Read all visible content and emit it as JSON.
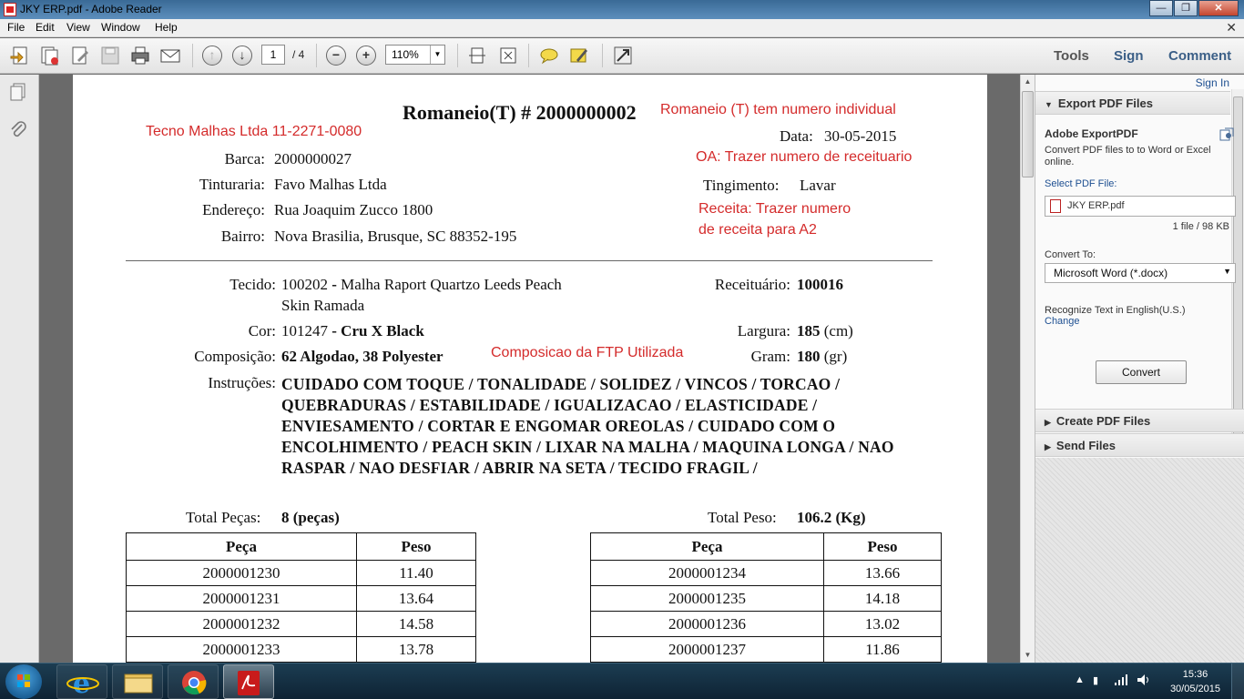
{
  "window": {
    "title": "JKY ERP.pdf - Adobe Reader",
    "buttons": {
      "minimize": "—",
      "maximize": "❐",
      "close": "✕"
    }
  },
  "menu": [
    "File",
    "Edit",
    "View",
    "Window",
    "Help"
  ],
  "toolbar": {
    "page_current": "1",
    "page_total": "/ 4",
    "zoom": "110%",
    "links": [
      "Tools",
      "Sign",
      "Comment"
    ]
  },
  "document": {
    "title": "Romaneio(T) # 2000000002",
    "header_left": [
      {
        "label": "Barca:",
        "value": "2000000027"
      },
      {
        "label": "Tinturaria:",
        "value": "Favo Malhas Ltda"
      },
      {
        "label": "Endereço:",
        "value": "Rua Joaquim Zucco 1800"
      },
      {
        "label": "Bairro:",
        "value": "Nova Brasilia, Brusque, SC 88352-195"
      }
    ],
    "date": {
      "label": "Data:",
      "value": "30-05-2015"
    },
    "tingimento": {
      "label": "Tingimento:",
      "value": "Lavar"
    },
    "tecido": {
      "label": "Tecido:",
      "code": "100202",
      "sep": " - ",
      "line1": "Malha Raport Quartzo Leeds Peach",
      "line2": "Skin Ramada"
    },
    "cor": {
      "label": "Cor:",
      "code": "101247",
      "value": " - Cru X Black"
    },
    "composicao": {
      "label": "Composição:",
      "value": "62 Algodao, 38 Polyester"
    },
    "receituario": {
      "label": "Receituário:",
      "value": "100016"
    },
    "largura": {
      "label": "Largura:",
      "value": "185",
      "unit": " (cm)"
    },
    "gram": {
      "label": "Gram:",
      "value": "180",
      "unit": " (gr)"
    },
    "instrucoes": {
      "label": "Instruções:",
      "text": "CUIDADO COM TOQUE / TONALIDADE / SOLIDEZ / VINCOS / TORCAO / QUEBRADURAS / ESTABILIDADE / IGUALIZACAO / ELASTICIDADE / ENVIESAMENTO / CORTAR E ENGOMAR OREOLAS / CUIDADO COM O ENCOLHIMENTO / PEACH SKIN / LIXAR NA MALHA / MAQUINA LONGA / NAO RASPAR / NAO DESFIAR / ABRIR NA SETA / TECIDO FRAGIL /"
    },
    "total_pecas": {
      "label": "Total Peças:",
      "value": "8 (peças)"
    },
    "total_peso": {
      "label": "Total Peso:",
      "value": "106.2 (Kg)"
    },
    "table_headers": [
      "Peça",
      "Peso"
    ],
    "table_left": [
      [
        "2000001230",
        "11.40"
      ],
      [
        "2000001231",
        "13.64"
      ],
      [
        "2000001232",
        "14.58"
      ],
      [
        "2000001233",
        "13.78"
      ]
    ],
    "table_right": [
      [
        "2000001234",
        "13.66"
      ],
      [
        "2000001235",
        "14.18"
      ],
      [
        "2000001236",
        "13.02"
      ],
      [
        "2000001237",
        "11.86"
      ]
    ],
    "annotations": {
      "company": "Tecno Malhas Ltda  11-2271-0080",
      "romaneio_note": "Romaneio (T) tem numero individual",
      "oa_note": "OA: Trazer numero de receituario",
      "receita_note_1": "Receita: Trazer numero",
      "receita_note_2": "de receita para A2",
      "composicao_note": "Composicao da FTP Utilizada"
    },
    "annotation_color": "#d42b2b"
  },
  "right_panel": {
    "sign_in": "Sign In",
    "export_header": "Export PDF Files",
    "service_name": "Adobe ExportPDF",
    "description": "Convert PDF files to to Word or Excel online.",
    "select_label": "Select PDF File:",
    "file_name": "JKY ERP.pdf",
    "file_info": "1 file / 98 KB",
    "convert_to_label": "Convert To:",
    "convert_to_value": "Microsoft Word (*.docx)",
    "recognize_text": "Recognize Text in English(U.S.)",
    "change_link": "Change",
    "convert_button": "Convert",
    "create_header": "Create PDF Files",
    "send_header": "Send Files"
  },
  "taskbar": {
    "time": "15:36",
    "date": "30/05/2015",
    "apps": [
      "internet-explorer",
      "windows-explorer",
      "chrome",
      "adobe-reader"
    ]
  }
}
